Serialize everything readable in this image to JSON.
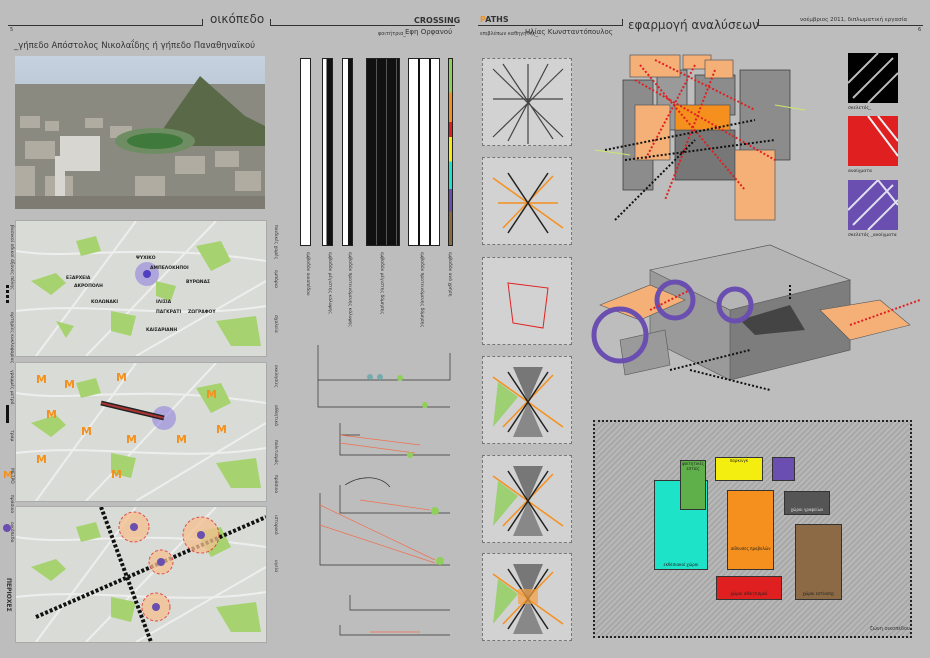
{
  "left_page": {
    "page_number": "5",
    "section_title": "οικόπεδο",
    "site_caption": "_γήπεδο Απόστολος Νικολαΐδης ή γήπεδο Παναθηναϊκού",
    "map_labels": [
      "ΨΥΧΙΚΟ",
      "ΑΜΠΕΛΟΚΗΠΟΙ",
      "ΕΞΑΡΧΕΙΑ",
      "ΑΚΡΟΠΟΛΗ",
      "ΚΟΛΩΝΑΚΙ",
      "ΒΥΡΩΝΑΣ",
      "ΖΩΓΡΑΦΟΥ",
      "ΙΛΙΣΙΑ",
      "ΚΑΙΣΑΡΙΑΝΗ",
      "ΠΑΓΚΡΑΤΙ"
    ],
    "side_labels": {
      "main_axes": "βασικοί οδικοί άξονες πόλης",
      "arrows": "αρτηρίες κυκλοφορίας",
      "metro": "ΜΕΤΡΟ",
      "metro_lines": "γραμμές μετρό",
      "tram": "τραμ",
      "green": "πράσινο",
      "site": "οικόπεδο",
      "areas": "ΠΕΡΙΟΧΕΣ"
    },
    "legend_right": [
      "παιδικές χαρές",
      "εμπόριο",
      "σχολεία",
      "εκκλησίες",
      "αθλητικά",
      "πολιτισμός",
      "πράσινο",
      "ιστορικό",
      "υγεία"
    ],
    "crossing": {
      "title": "CROSSING",
      "advisor_label": "φοιτήτρια_",
      "advisor_name": "Εφη Ορφανού"
    },
    "bar_labels": [
      "εμβαδόν οικοπέδου",
      "εμβαδόν μέγιστης κάλυψης",
      "εμβαδόν προτεινόμενης κάλυψης",
      "εμβαδόν μέγιστης δόμησης",
      "εμβαδόν προτεινόμενης δόμησης",
      "εμβαδόν ανά χρήση"
    ]
  },
  "right_page": {
    "paths": {
      "title": "PATHS",
      "supervisor_label": "επιβλέπων καθηγητής_",
      "supervisor_name": "Ηλίας Κωνσταντόπουλος"
    },
    "section_title": "εφαρμογή αναλύσεων",
    "date_text": "νοέμβριος 2011, διπλωματική εργασία",
    "page_number": "6",
    "icons": [
      {
        "label": "σκελετός_",
        "color": "#000000"
      },
      {
        "label": "ανοίγματα",
        "color": "#e02020"
      },
      {
        "label": "σκελετός _ανοίγματα",
        "color": "#6a4fb0"
      }
    ],
    "plan_blocks": [
      {
        "label": "φοιτητικές εστίες",
        "color": "#5fb04a"
      },
      {
        "label": "εκθεσιακοί χώροι",
        "color": "#1de3c8"
      },
      {
        "label": "παρκινγκ",
        "color": "#f4ee10"
      },
      {
        "label": "",
        "color": "#6a4fb0"
      },
      {
        "label": "χώροι γραφείων",
        "color": "#555555"
      },
      {
        "label": "αίθουσες προβολών",
        "color": "#f5901e"
      },
      {
        "label": "χώροι εστίασης",
        "color": "#8b6a45"
      },
      {
        "label": "χώροι αθλητισμού",
        "color": "#e02020"
      }
    ],
    "plan_caption": "ζώνη οικοπέδου"
  },
  "colors": {
    "background": "#bdbdbd",
    "orange": "#f5901e",
    "purple": "#6a4fb0",
    "green": "#8fcf5a",
    "red": "#e02020"
  }
}
